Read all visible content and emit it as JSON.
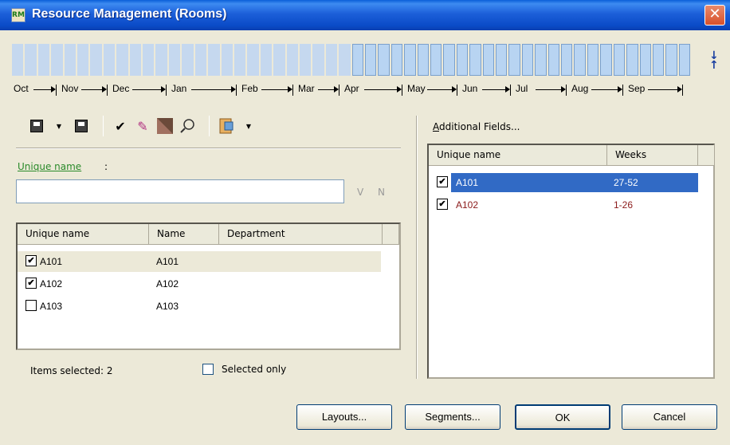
{
  "window": {
    "title": "Resource Management (Rooms)",
    "icon_text": "RM",
    "close_label": "✕"
  },
  "timeline": {
    "months": [
      "Oct",
      "Nov",
      "Dec",
      "Jan",
      "Feb",
      "Mar",
      "Apr",
      "May",
      "Jun",
      "Jul",
      "Aug",
      "Sep"
    ],
    "weeks_total": 52,
    "weeks_active_range": [
      27,
      52
    ]
  },
  "fields": {
    "unique_name_label": "Unique name",
    "colon": ":",
    "unique_name_value": "",
    "v_label": "V",
    "n_label": "N"
  },
  "left_list": {
    "columns": [
      "Unique name",
      "Name",
      "Department"
    ],
    "rows": [
      {
        "checked": true,
        "unique": "A101",
        "name": "A101",
        "department": ""
      },
      {
        "checked": true,
        "unique": "A102",
        "name": "A102",
        "department": ""
      },
      {
        "checked": false,
        "unique": "A103",
        "name": "A103",
        "department": ""
      }
    ]
  },
  "status": {
    "items_selected": "Items selected: 2",
    "selected_only_label": "Selected only",
    "selected_only_checked": false
  },
  "right_panel": {
    "additional_fields_label": "Additional Fields...",
    "columns": [
      "Unique name",
      "Weeks"
    ],
    "rows": [
      {
        "checked": true,
        "unique": "A101",
        "weeks": "27-52",
        "selected": true
      },
      {
        "checked": true,
        "unique": "A102",
        "weeks": "1-26",
        "selected": false
      }
    ]
  },
  "buttons": {
    "layouts": "Layouts...",
    "segments": "Segments...",
    "ok": "OK",
    "cancel": "Cancel"
  },
  "colors": {
    "selection": "#316ac5",
    "row_text_alt": "#8b1a1a",
    "highlight_row": "#ece9d8",
    "link_green": "#2a8a2a"
  },
  "icons": [
    "save-icon",
    "save-as-icon",
    "check-icon",
    "eraser-icon",
    "fill-icon",
    "search-icon",
    "export-icon",
    "sort-icon"
  ]
}
